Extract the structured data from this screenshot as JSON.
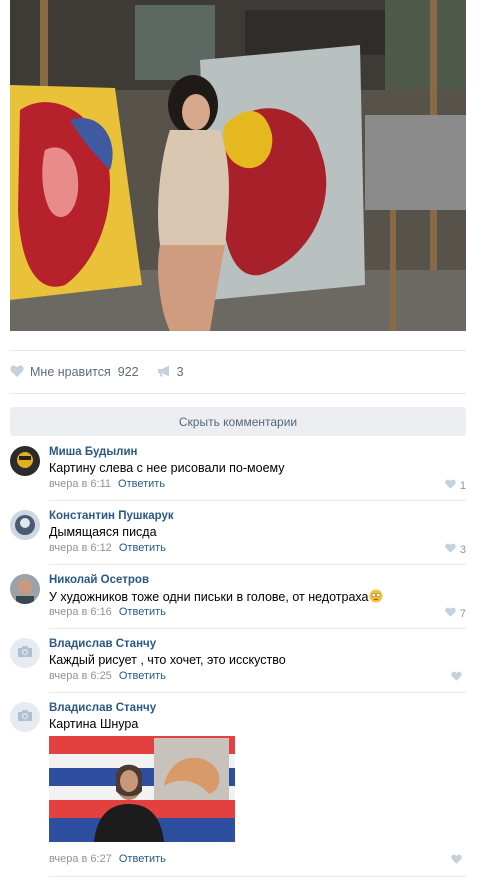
{
  "post": {
    "likes": {
      "label": "Мне нравится",
      "count": "922"
    },
    "shares": {
      "count": "3"
    }
  },
  "hide_comments_label": "Скрыть комментарии",
  "reply_label": "Ответить",
  "comments": [
    {
      "author": "Миша Будылин",
      "text": "Картину слева с нее рисовали по-моему",
      "time": "вчера в 6:11",
      "likes": "1"
    },
    {
      "author": "Константин Пушкарук",
      "text": "Дымящаяся писда",
      "time": "вчера в 6:12",
      "likes": "3"
    },
    {
      "author": "Николай Осетров",
      "text": "У художников тоже одни письки в голове, от недотраха",
      "time": "вчера в 6:16",
      "likes": "7"
    },
    {
      "author": "Владислав Станчу",
      "text": "Каждый рисует , что хочет, это исскуство",
      "time": "вчера в 6:25",
      "likes": ""
    },
    {
      "author": "Владислав Станчу",
      "text": "Картина Шнура",
      "time": "вчера в 6:27",
      "likes": ""
    }
  ],
  "colors": {
    "link": "#2a5885",
    "meta": "#939393",
    "button_bg": "#eceef1",
    "divider": "#e7e8ec"
  },
  "icons": [
    "heart-icon",
    "megaphone-icon",
    "camera-icon",
    "emoji-icon"
  ]
}
